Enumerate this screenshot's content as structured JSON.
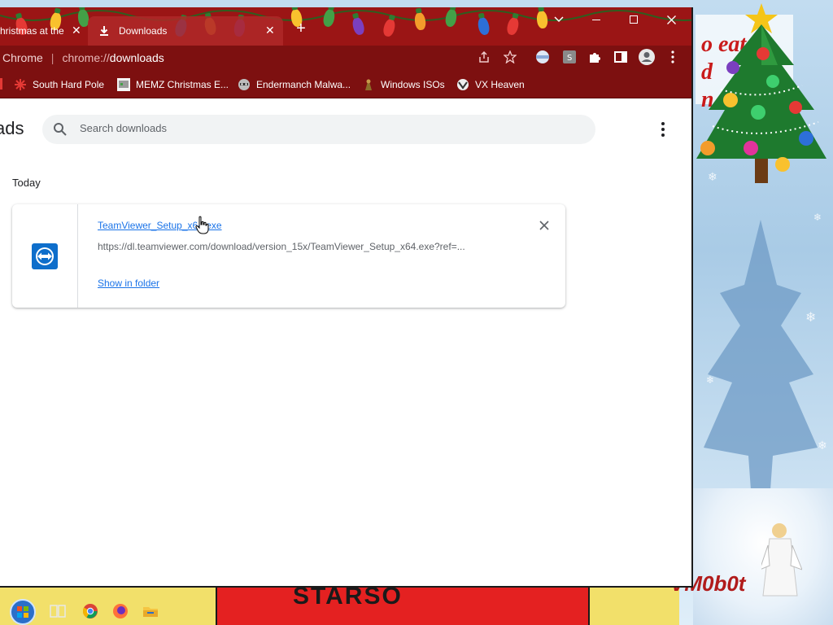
{
  "browser": {
    "tabs": [
      {
        "label": "hristmas at the",
        "active": false
      },
      {
        "label": "Downloads",
        "active": true,
        "icon": "download-icon"
      }
    ],
    "window_controls": [
      "chevron-down-icon",
      "minimize-icon",
      "maximize-icon",
      "close-icon"
    ],
    "omnibox": {
      "brand": "Chrome",
      "url_scheme": "chrome://",
      "url_path": "downloads"
    },
    "toolbar_icons": [
      "share-icon",
      "bookmark-star-icon",
      "extension-badge-icon",
      "extension-s-icon",
      "extensions-puzzle-icon",
      "side-panel-icon",
      "profile-icon",
      "chrome-menu-icon"
    ],
    "bookmarks": [
      {
        "label": "South Hard Pole",
        "icon": "snowflake-icon"
      },
      {
        "label": "MEMZ Christmas E...",
        "icon": "memz-icon"
      },
      {
        "label": "Endermanch Malwa...",
        "icon": "raccoon-icon"
      },
      {
        "label": "Windows ISOs",
        "icon": "figure-icon"
      },
      {
        "label": "VX Heaven",
        "icon": "vx-heaven-icon"
      }
    ],
    "theme_colors": {
      "frame": "#9b1515",
      "toolbar": "#7d1010"
    }
  },
  "downloads_page": {
    "title": "ads",
    "search": {
      "placeholder": "Search downloads",
      "value": ""
    },
    "date_heading": "Today",
    "items": [
      {
        "file_name": "TeamViewer_Setup_x64.exe",
        "url": "https://dl.teamviewer.com/download/version_15x/TeamViewer_Setup_x64.exe?ref=...",
        "action_label": "Show in folder",
        "icon": "teamviewer-icon"
      }
    ],
    "accent_color": "#1a73e8"
  },
  "desktop": {
    "wallpaper_text": [
      "o eat it",
      "d",
      "n"
    ],
    "signature": "VM0b0t",
    "sign_text": "STARSO"
  },
  "taskbar": {
    "icons": [
      "start-button-icon",
      "task-view-icon",
      "chrome-icon",
      "firefox-icon",
      "file-explorer-icon"
    ]
  }
}
